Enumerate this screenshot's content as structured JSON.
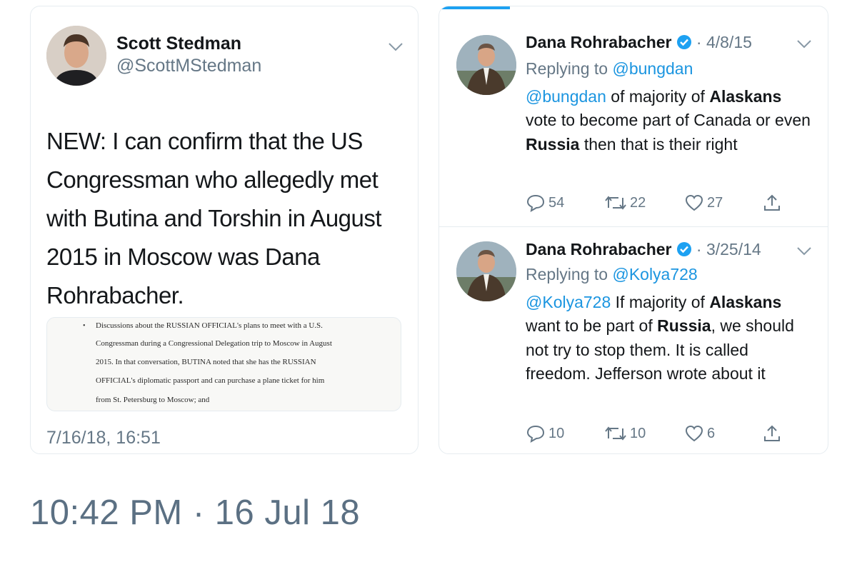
{
  "left_tweet": {
    "name": "Scott Stedman",
    "handle": "@ScottMStedman",
    "body": "NEW: I can confirm that the US Congressman who allegedly met with Butina and Torshin in August 2015 in Moscow was Dana Rohrabacher.",
    "timestamp": "7/16/18, 16:51",
    "document_image": {
      "bullet": "•",
      "lines": [
        "Discussions about the RUSSIAN OFFICIAL's plans to meet with a U.S.",
        "Congressman during a Congressional Delegation trip to Moscow in August",
        "2015.  In that conversation, BUTINA noted that she has the RUSSIAN",
        "OFFICIAL's diplomatic passport and can purchase a plane ticket for him",
        "from St. Petersburg to Moscow; and"
      ]
    }
  },
  "right_tweets": [
    {
      "name": "Dana Rohrabacher",
      "date": "· 4/8/15",
      "replying_prefix": "Replying to ",
      "replying_to": "@bungdan",
      "body_mention": "@bungdan",
      "body_1": " of majority of ",
      "body_bold_1": "Alaskans",
      "body_2": " vote to become part of Canada or even ",
      "body_bold_2": "Russia",
      "body_3": " then that is their right",
      "replies": "54",
      "retweets": "22",
      "likes": "27"
    },
    {
      "name": "Dana Rohrabacher",
      "date": "· 3/25/14",
      "replying_prefix": "Replying to ",
      "replying_to": "@Kolya728",
      "body_mention": "@Kolya728",
      "body_1": " If majority of ",
      "body_bold_1": "Alaskans",
      "body_2": " want to be part of ",
      "body_bold_2": "Russia",
      "body_3": ", we should not try to stop them. It is called freedom. Jefferson wrote about it",
      "replies": "10",
      "retweets": "10",
      "likes": "6"
    }
  ],
  "screenshot_time": "10:42 PM · 16 Jul 18",
  "icons": {
    "verified": "verified-badge-icon",
    "reply": "reply-icon",
    "retweet": "retweet-icon",
    "like": "heart-icon",
    "share": "share-icon",
    "chevron": "chevron-down-icon"
  },
  "colors": {
    "accent": "#1da1f2",
    "link": "#1b95e0",
    "secondary_text": "#657786",
    "primary_text": "#14171a",
    "footer_time": "#5b7083"
  }
}
